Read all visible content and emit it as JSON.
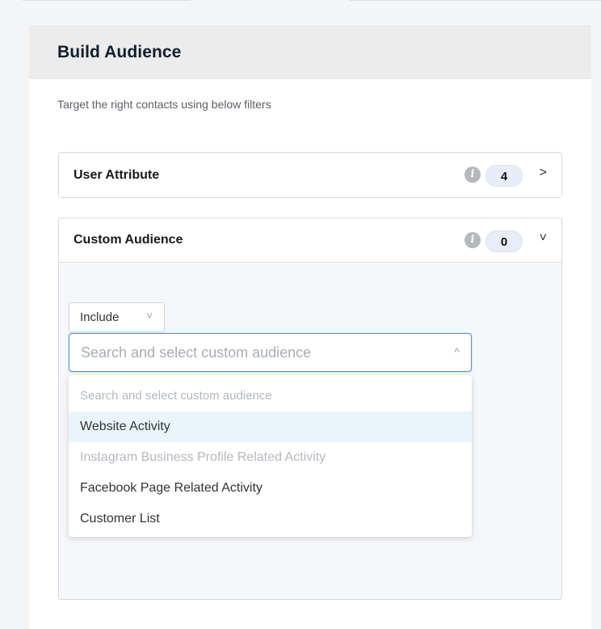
{
  "panel": {
    "title": "Build Audience",
    "subtitle": "Target the right contacts using below filters"
  },
  "sections": {
    "user_attribute": {
      "label": "User Attribute",
      "count": "4",
      "chevron": ">"
    },
    "custom_audience": {
      "label": "Custom Audience",
      "count": "0",
      "chevron": "˅"
    }
  },
  "icons": {
    "info": "i",
    "include_chevron": "˅",
    "search_chevron": "^"
  },
  "include_select": {
    "value": "Include"
  },
  "search": {
    "placeholder": "Search and select custom audience"
  },
  "dropdown": {
    "options": [
      {
        "label": "Search and select custom audience",
        "state": "placeholder"
      },
      {
        "label": "Website Activity",
        "state": "highlighted"
      },
      {
        "label": "Instagram Business Profile Related Activity",
        "state": "disabled"
      },
      {
        "label": "Facebook Page Related Activity",
        "state": "normal"
      },
      {
        "label": "Customer List",
        "state": "normal"
      }
    ]
  },
  "colors": {
    "header_bg": "#ececec",
    "focus_border": "#4f93d8",
    "highlight_bg": "#e8f6fc",
    "badge_bg": "#e8eef8"
  }
}
